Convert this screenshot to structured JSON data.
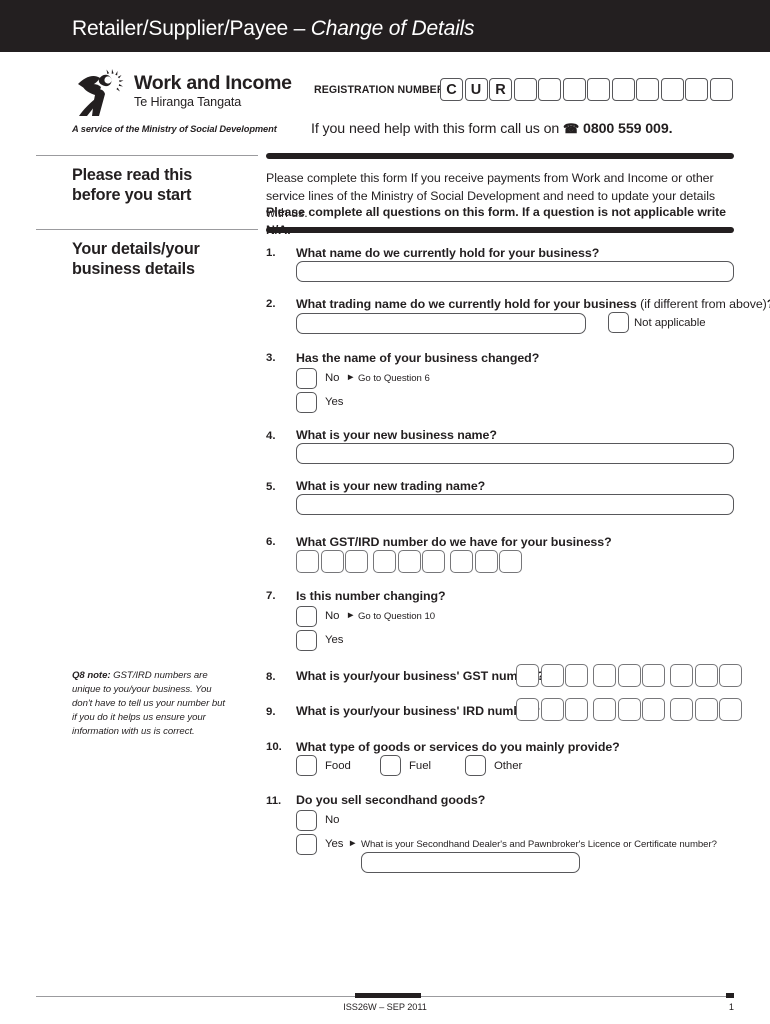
{
  "header": {
    "title_main": "Retailer/Supplier/Payee – ",
    "title_italic": "Change of Details"
  },
  "logo": {
    "name": "Work and Income",
    "maori_name": "Te Hiranga Tangata",
    "tagline": "A service of the Ministry of Social Development"
  },
  "registration": {
    "label": "REGISTRATION NUMBER",
    "prefilled": [
      "C",
      "U",
      "R"
    ],
    "empty_box_count": 9
  },
  "help": {
    "text_before": "If you need help with this form call us on ",
    "phone_icon": "☎",
    "phone": "0800 559 009."
  },
  "sections": [
    {
      "heading_line1": "Please read this",
      "heading_line2": "before you start"
    },
    {
      "heading_line1": "Your details/your",
      "heading_line2": "business details"
    }
  ],
  "intro": {
    "paragraph": "Please complete this form If you receive payments from Work and Income or other service lines of the Ministry of Social Development and need to update your details with us.",
    "bold_note": "Please complete all questions on this form. If a question is not applicable write N/A."
  },
  "questions": {
    "q1": {
      "number": "1.",
      "text": "What name do we currently hold for your business?"
    },
    "q2": {
      "number": "2.",
      "text_bold": "What trading name do we currently hold for your business ",
      "text_light": "(if different from above)",
      "text_tail": "?",
      "not_applicable_label": "Not applicable"
    },
    "q3": {
      "number": "3.",
      "text": "Has the name of your business changed?",
      "option_no": "No",
      "goto_no": "Go to Question 6",
      "option_yes": "Yes"
    },
    "q4": {
      "number": "4.",
      "text": "What is your new business name?"
    },
    "q5": {
      "number": "5.",
      "text": "What is your new trading name?"
    },
    "q6": {
      "number": "6.",
      "text": "What GST/IRD number do we have for your business?",
      "box_count": 9
    },
    "q7": {
      "number": "7.",
      "text": "Is this number changing?",
      "option_no": "No",
      "goto_no": "Go to Question 10",
      "option_yes": "Yes"
    },
    "q8": {
      "number": "8.",
      "text": "What is your/your business' GST number?",
      "box_count": 9
    },
    "q9": {
      "number": "9.",
      "text": "What is your/your business' IRD number?",
      "box_count": 9
    },
    "q10": {
      "number": "10.",
      "text": "What type of goods or services do you mainly provide?",
      "options": [
        "Food",
        "Fuel",
        "Other"
      ]
    },
    "q11": {
      "number": "11.",
      "text": "Do you sell secondhand goods?",
      "option_no": "No",
      "option_yes": "Yes",
      "followup": "What is your Secondhand Dealer's and Pawnbroker's Licence or Certificate number?"
    }
  },
  "side_note": {
    "label": "Q8 note:",
    "text": " GST/IRD numbers are unique to you/your business. You don't have to tell us your number but if you do it helps us ensure your information with us is correct."
  },
  "footer": {
    "code": "ISS26W – SEP 2011",
    "page": "1"
  },
  "colors": {
    "ink": "#231f20",
    "rule": "#9b9b9e",
    "box_border": "#58585b"
  }
}
